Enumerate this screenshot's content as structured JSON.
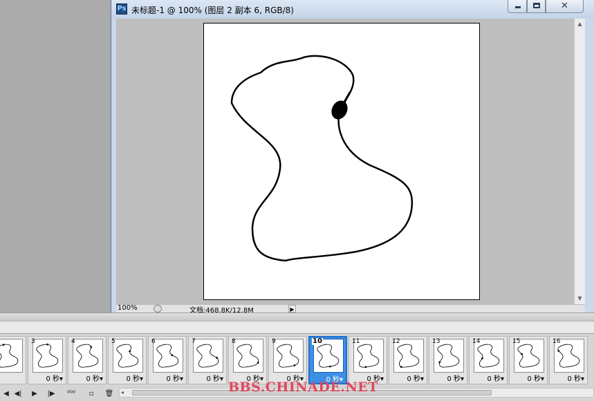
{
  "window": {
    "title": "未标题-1 @ 100% (图层 2 副本 6, RGB/8)",
    "app_icon": "photoshop-icon",
    "controls": [
      "minimize-icon",
      "maximize-icon",
      "close-icon"
    ],
    "close_symbol": "✕"
  },
  "statusbar": {
    "zoom": "100%",
    "doc_size": "文档:468.8K/12.8M",
    "menu_arrow": "▶"
  },
  "colors": {
    "selected_frame": "#3d8fe3",
    "watermark": "#e0485c"
  },
  "animation": {
    "frames": [
      {
        "num": "",
        "delay": "",
        "progress": 0.07
      },
      {
        "num": "3",
        "delay": "0 秒▾",
        "progress": 0.12
      },
      {
        "num": "4",
        "delay": "0 秒▾",
        "progress": 0.18
      },
      {
        "num": "5",
        "delay": "0 秒▾",
        "progress": 0.24
      },
      {
        "num": "6",
        "delay": "0 秒▾",
        "progress": 0.3
      },
      {
        "num": "7",
        "delay": "0 秒▾",
        "progress": 0.37
      },
      {
        "num": "8",
        "delay": "0 秒▾",
        "progress": 0.44
      },
      {
        "num": "9",
        "delay": "0 秒▾",
        "progress": 0.5
      },
      {
        "num": "10",
        "delay": "0 秒▾",
        "progress": 0.56,
        "selected": true
      },
      {
        "num": "11",
        "delay": "0 秒▾",
        "progress": 0.62
      },
      {
        "num": "12",
        "delay": "0 秒▾",
        "progress": 0.68
      },
      {
        "num": "13",
        "delay": "0 秒▾",
        "progress": 0.75
      },
      {
        "num": "14",
        "delay": "0 秒▾",
        "progress": 0.81
      },
      {
        "num": "15",
        "delay": "0 秒▾",
        "progress": 0.87
      },
      {
        "num": "16",
        "delay": "0 秒▾",
        "progress": 0.93
      }
    ],
    "controls": {
      "first_frame": "◀",
      "prev_frame": "◀|",
      "play": "▶",
      "next_frame": "|▶",
      "tween": "⁰⁰⁰",
      "new_frame": "▫",
      "delete_frame": "🗑",
      "scroll_left": "◂"
    },
    "control_icons": [
      "first-frame-icon",
      "previous-frame-icon",
      "play-icon",
      "next-frame-icon",
      "tween-icon",
      "new-frame-icon",
      "trash-icon"
    ]
  },
  "watermark": "BBS.CHINADE.NET"
}
